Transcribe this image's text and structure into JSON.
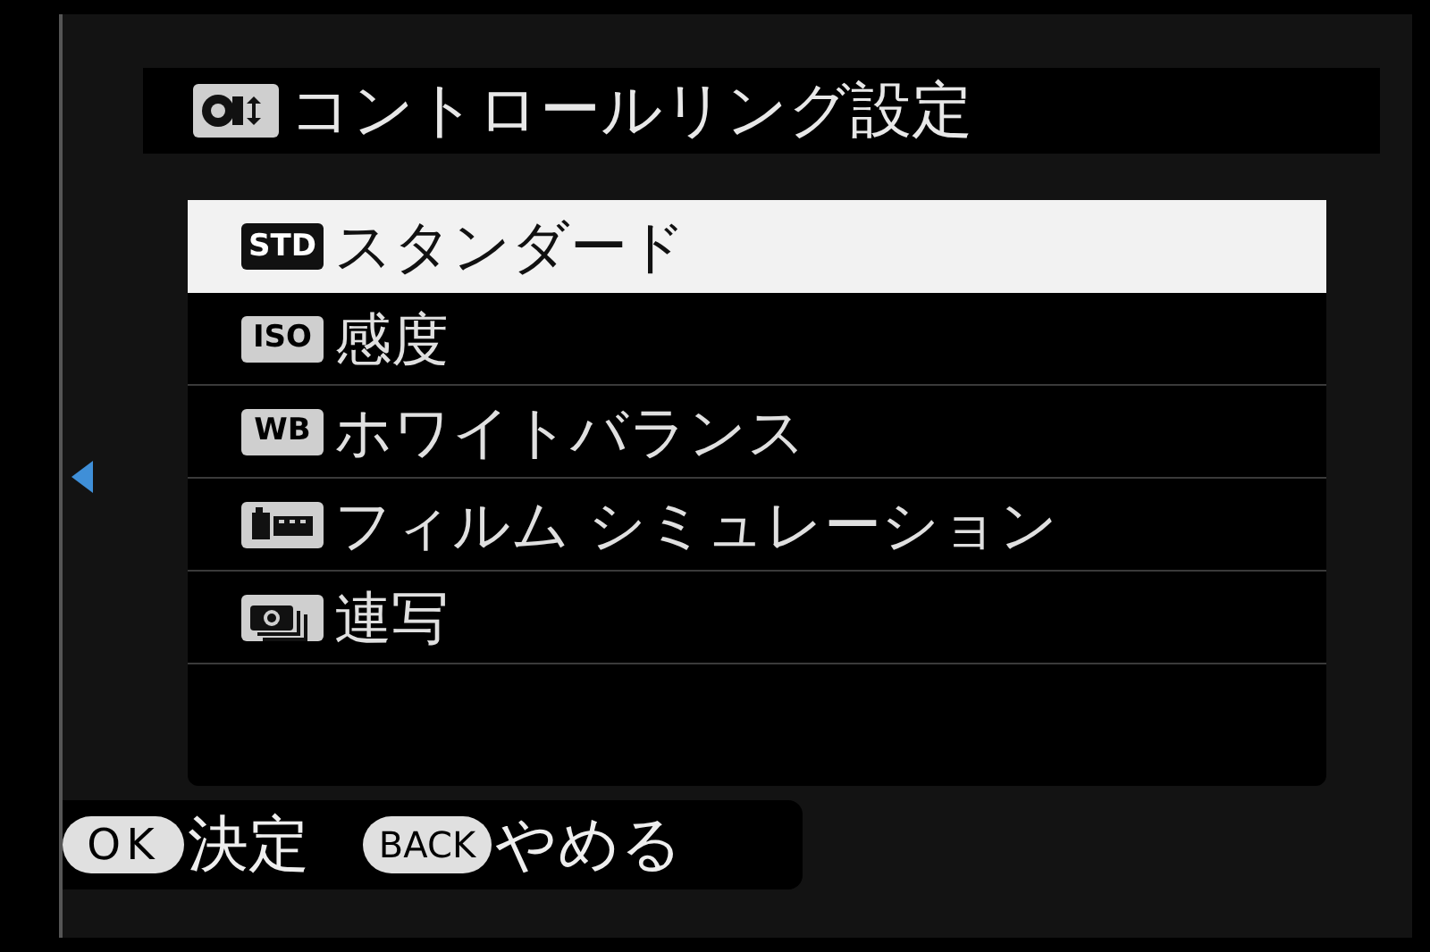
{
  "header": {
    "title": "コントロールリング設定"
  },
  "items": [
    {
      "kind": "badge",
      "badge": "STD",
      "label": "スタンダード",
      "selected": true
    },
    {
      "kind": "badge",
      "badge": "ISO",
      "label": "感度",
      "selected": false
    },
    {
      "kind": "badge",
      "badge": "WB",
      "label": "ホワイトバランス",
      "selected": false
    },
    {
      "kind": "film",
      "label": "フィルム シミュレーション",
      "selected": false
    },
    {
      "kind": "burst",
      "label": "連写",
      "selected": false
    }
  ],
  "footer": [
    {
      "key": "OK",
      "label": "決定"
    },
    {
      "key": "BACK",
      "label": "やめる"
    }
  ]
}
